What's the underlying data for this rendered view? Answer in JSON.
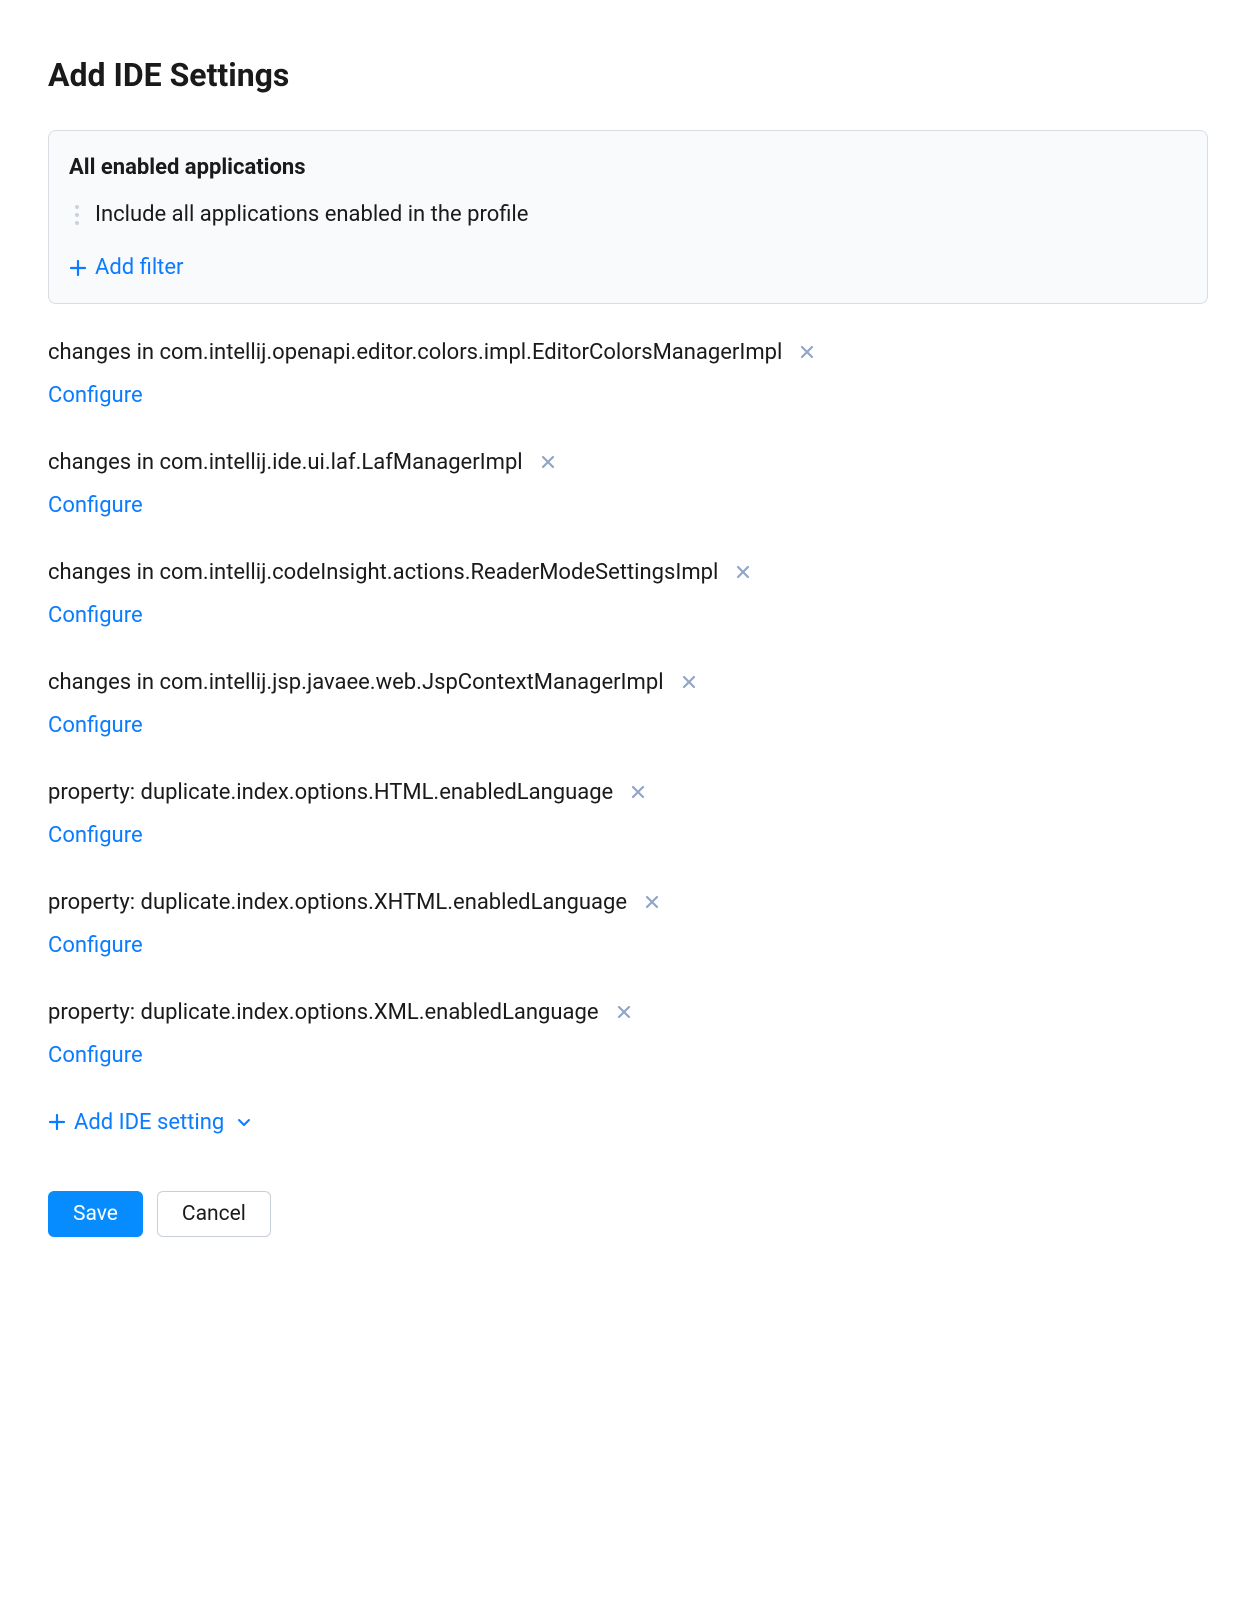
{
  "page_title": "Add IDE Settings",
  "applications_panel": {
    "title": "All enabled applications",
    "description": "Include all applications enabled in the profile",
    "add_filter_label": "Add filter"
  },
  "settings": [
    {
      "label": "changes in com.intellij.openapi.editor.colors.impl.EditorColorsManagerImpl",
      "configure_label": "Configure"
    },
    {
      "label": "changes in com.intellij.ide.ui.laf.LafManagerImpl",
      "configure_label": "Configure"
    },
    {
      "label": "changes in com.intellij.codeInsight.actions.ReaderModeSettingsImpl",
      "configure_label": "Configure"
    },
    {
      "label": "changes in com.intellij.jsp.javaee.web.JspContextManagerImpl",
      "configure_label": "Configure"
    },
    {
      "label": "property: duplicate.index.options.HTML.enabledLanguage",
      "configure_label": "Configure"
    },
    {
      "label": "property: duplicate.index.options.XHTML.enabledLanguage",
      "configure_label": "Configure"
    },
    {
      "label": "property: duplicate.index.options.XML.enabledLanguage",
      "configure_label": "Configure"
    }
  ],
  "add_setting_label": "Add IDE setting",
  "buttons": {
    "save": "Save",
    "cancel": "Cancel"
  }
}
